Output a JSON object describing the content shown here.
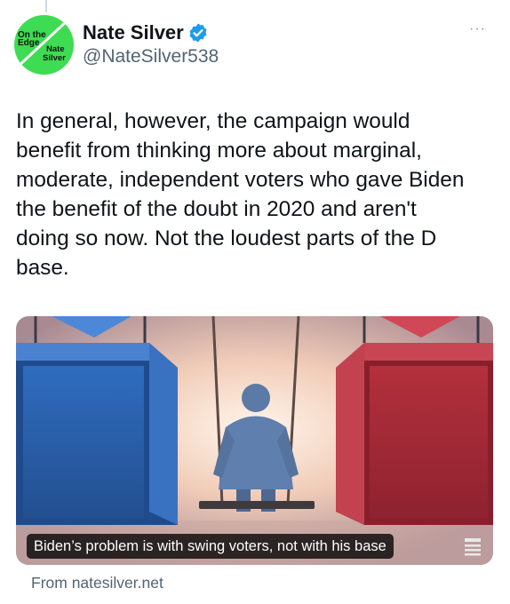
{
  "author": {
    "name": "Nate Silver",
    "handle": "@NateSilver538",
    "avatar_text": [
      "On the",
      "Edge",
      "Nate",
      "Silver"
    ]
  },
  "tweet": {
    "text": "In general, however, the campaign would\nbenefit from thinking more about marginal,\nmoderate, independent voters who gave Biden\nthe benefit of the doubt in 2020 and aren't\ndoing so now. Not the loudest parts of the D\nbase."
  },
  "card": {
    "caption": "Biden’s problem is with swing voters, not with his base",
    "source": "From natesilver.net"
  },
  "menu": {
    "more_label": "···"
  },
  "colors": {
    "avatar_bg": "#3ddc52",
    "verified": "#1d9bf0",
    "secondary_text": "#536471",
    "blue_box": "#2a5ea8",
    "red_box": "#b3303c"
  },
  "icons": {
    "verified": "verified-badge-icon",
    "more": "more-horizontal-icon",
    "article": "article-icon"
  }
}
